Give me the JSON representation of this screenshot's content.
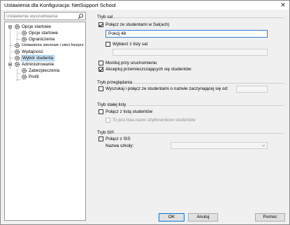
{
  "window": {
    "title": "Ustawienia dla Konfiguracja: NetSupport School",
    "close_glyph": "✕"
  },
  "search": {
    "placeholder": "Ustawienia wyszukiwania",
    "icon": "search-icon"
  },
  "tree": {
    "items": [
      {
        "label": "Opcje startowe",
        "level": 1,
        "expanded": true
      },
      {
        "label": "Opcje startowe",
        "level": 2
      },
      {
        "label": "Ograniczenia",
        "level": 2
      },
      {
        "label": "Ustawienia sieciowe i sieci bezprz",
        "level": 1
      },
      {
        "label": "Wydajność",
        "level": 1
      },
      {
        "label": "Wybór studenta",
        "level": 1,
        "selected": true
      },
      {
        "label": "Administrowanie",
        "level": 1,
        "expanded": true
      },
      {
        "label": "Zabezpieczenia",
        "level": 2
      },
      {
        "label": "Profil",
        "level": 2
      }
    ]
  },
  "room_mode": {
    "title": "Tryb sal",
    "connect_label": "Połącz ze studentami w Sal(ach)",
    "connect_checked": true,
    "room_value": "Pokój 48",
    "choose_label": "Wybierz z listy sal",
    "choose_checked": false,
    "prompt_label": "Monituj przy uruchomieniu",
    "prompt_checked": false,
    "accept_label": "Akceptuj przemieszczających się studentów",
    "accept_checked": true
  },
  "browse_mode": {
    "title": "Tryb przeglądania",
    "search_label": "Wyszukaj i połącz ze studentami o nazwie zaczynającej się od:",
    "search_checked": false,
    "value": ""
  },
  "fixed_list": {
    "title": "Tryb stałej listy",
    "connect_label": "Połącz z listą studentów",
    "connect_checked": false,
    "username_label": "To jest lista nazw użytkowników studentów",
    "username_checked": false
  },
  "sis_mode": {
    "title": "Tryb SIS",
    "connect_label": "Połącz z SIS",
    "connect_checked": false,
    "school_label": "Nazwa szkoły:",
    "school_value": ""
  },
  "buttons": {
    "ok": "OK",
    "cancel": "Anuluj",
    "help": "Pomoc"
  }
}
